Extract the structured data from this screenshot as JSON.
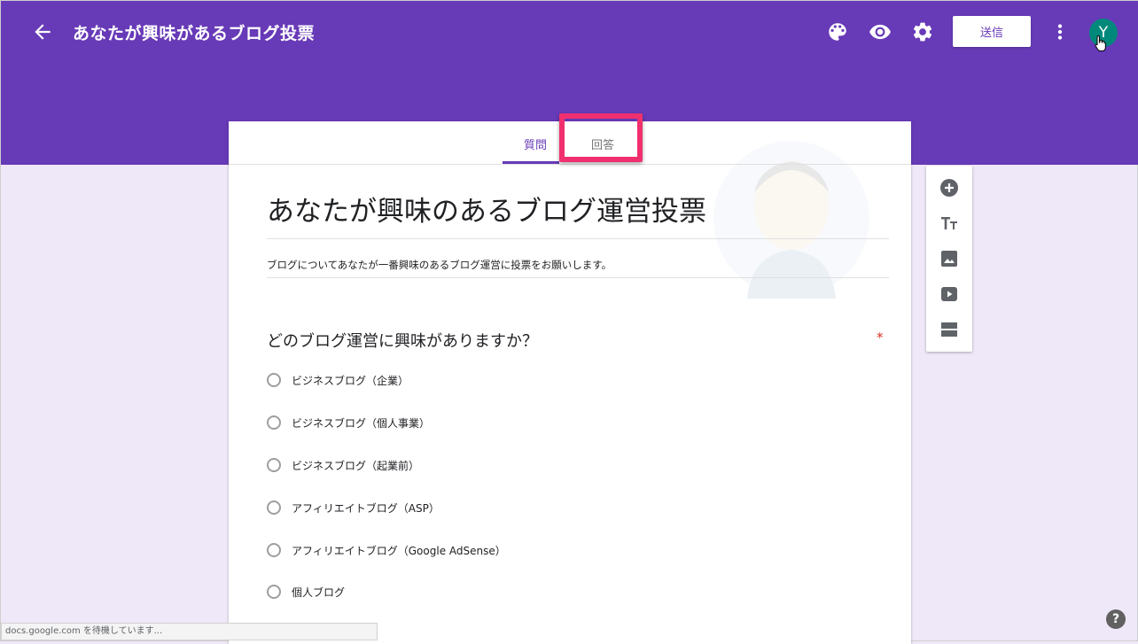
{
  "header": {
    "form_title": "あなたが興味があるブログ投票",
    "send_label": "送信",
    "avatar_initial": "Y",
    "icons": [
      "back-arrow-icon",
      "palette-icon",
      "eye-icon",
      "gear-icon",
      "more-vert-icon"
    ],
    "bg_color": "#673ab7"
  },
  "tabs": [
    {
      "label": "質問",
      "active": true
    },
    {
      "label": "回答",
      "active": false
    }
  ],
  "form": {
    "title": "あなたが興味のあるブログ運営投票",
    "description": "ブログについてあなたが一番興味のあるブログ運営に投票をお願いします。",
    "question": "どのブログ運営に興味がありますか？",
    "required_mark": "*",
    "options": [
      "ビジネスブログ（企業）",
      "ビジネスブログ（個人事業）",
      "ビジネスブログ（起業前）",
      "アフィリエイトブログ（ASP）",
      "アフィリエイトブログ（Google AdSense）",
      "個人ブログ"
    ]
  },
  "side_toolbar": [
    "add-question-icon",
    "title-text-icon",
    "image-icon",
    "video-icon",
    "section-icon"
  ],
  "status_bar": "docs.google.com を待機しています...",
  "help": "?",
  "highlight_color": "#f0306e"
}
